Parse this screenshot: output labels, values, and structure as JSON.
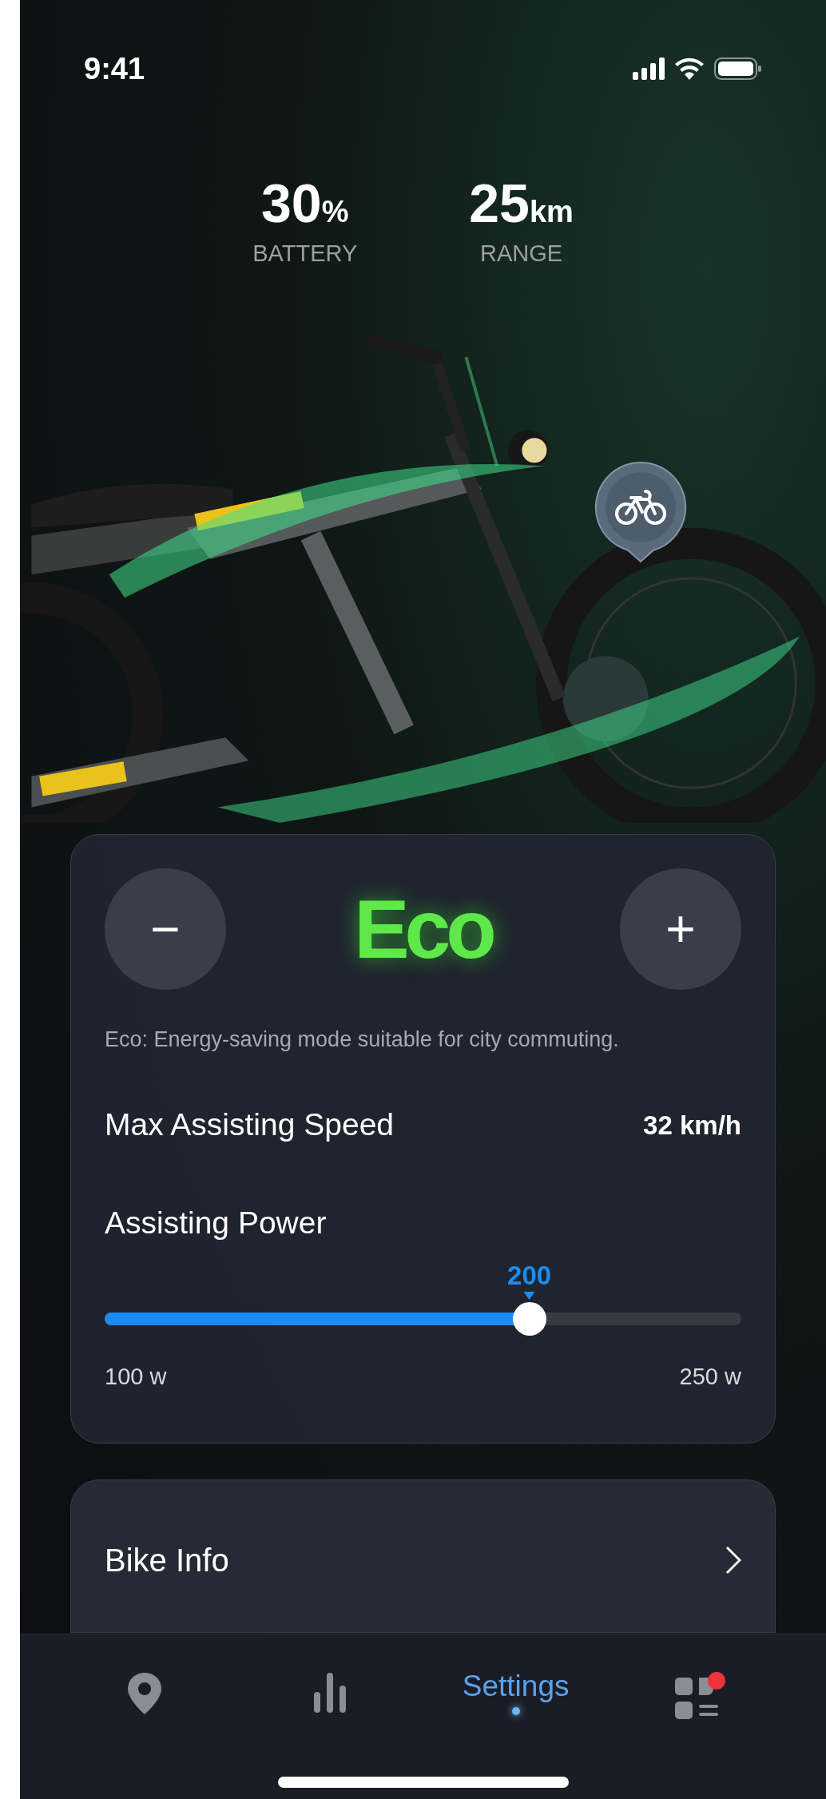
{
  "status_bar": {
    "time": "9:41"
  },
  "stats": [
    {
      "value": "30",
      "unit": "%",
      "label": "BATTERY"
    },
    {
      "value": "25",
      "unit": "km",
      "label": "RANGE"
    }
  ],
  "mode_card": {
    "decrease": "−",
    "mode": "Eco",
    "increase": "+",
    "description": "Eco: Energy-saving mode suitable for city commuting.",
    "max_speed": {
      "label": "Max Assisting Speed",
      "value": "32 km/h"
    },
    "power": {
      "label": "Assisting Power",
      "reading": "200",
      "level": 0.667,
      "min": "100 w",
      "max": "250 w"
    }
  },
  "bike_info": {
    "label": "Bike Info"
  },
  "nav": [
    {
      "kind": "pin",
      "selected": false
    },
    {
      "kind": "chart",
      "selected": false
    },
    {
      "kind": "label",
      "label": "Settings",
      "selected": true
    },
    {
      "kind": "grid",
      "selected": false,
      "badge": true
    }
  ]
}
